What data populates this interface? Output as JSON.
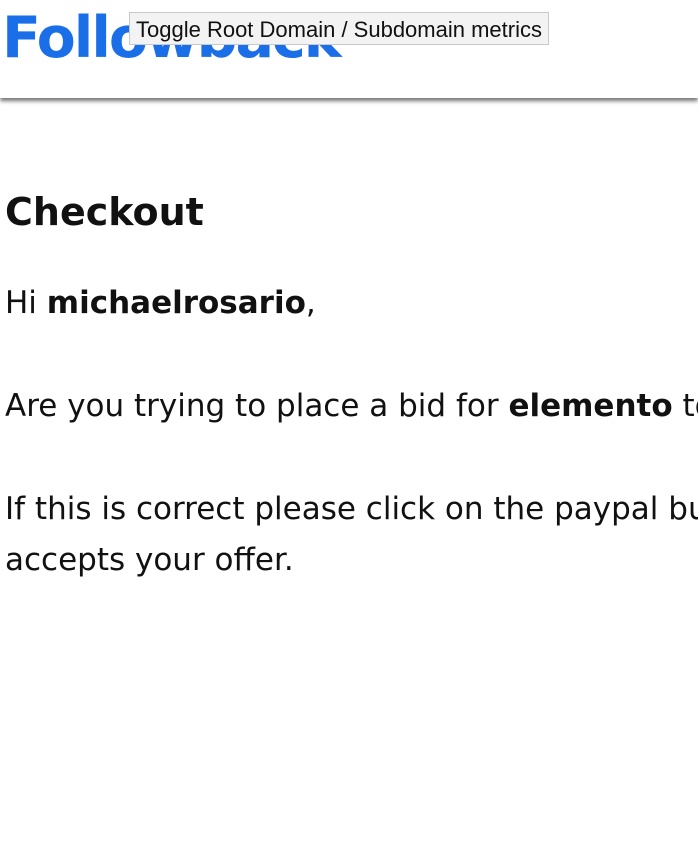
{
  "header": {
    "logo_text": "Followback",
    "logo_color": "#1a6fe8",
    "tooltip": "Toggle Root Domain / Subdomain metrics"
  },
  "main": {
    "title": "Checkout",
    "greeting": {
      "prefix": "Hi ",
      "username": "michaelrosario",
      "suffix": ","
    },
    "bid_line": {
      "prefix": "Are you trying to place a bid for ",
      "item": "elemento",
      "suffix": " to"
    },
    "instruction": {
      "line1": "If this is correct please click on the paypal bu",
      "line2": "accepts your offer."
    }
  }
}
